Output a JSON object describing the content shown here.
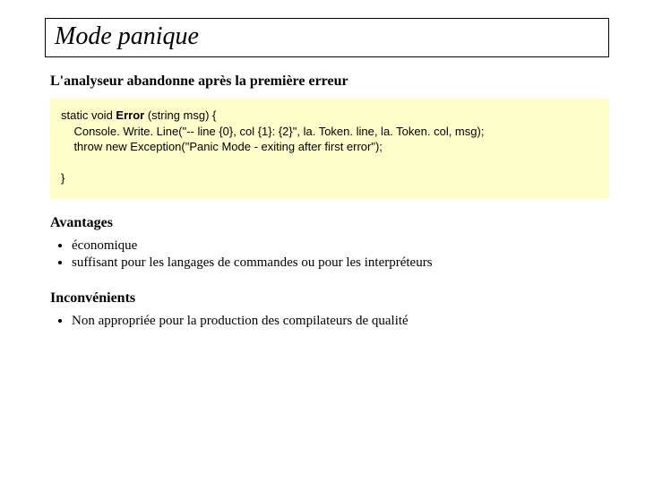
{
  "title": "Mode panique",
  "subtitle": "L'analyseur abandonne après la première erreur",
  "code": {
    "line1_pre": "static void ",
    "line1_bold": "Error",
    "line1_post": " (string msg) {",
    "line2": "    Console. Write. Line(\"-- line {0}, col {1}: {2}\", la. Token. line, la. Token. col, msg);",
    "line3": "    throw new Exception(\"Panic Mode - exiting after first error\");",
    "line4_blank": "",
    "line5": "}"
  },
  "advantages": {
    "heading": "Avantages",
    "items": [
      "économique",
      "suffisant pour les langages de commandes ou pour les interpréteurs"
    ]
  },
  "disadvantages": {
    "heading": "Inconvénients",
    "items": [
      "Non  appropriée pour la production des compilateurs de qualité"
    ]
  }
}
